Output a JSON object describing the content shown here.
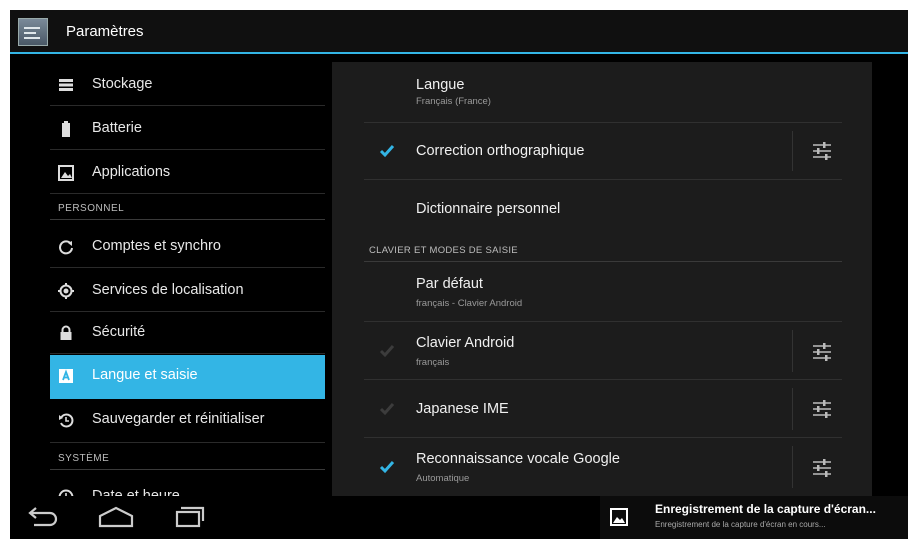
{
  "action_bar": {
    "title": "Paramètres"
  },
  "left_pane": {
    "items_top": [
      {
        "label": "Stockage",
        "icon": "storage-icon"
      },
      {
        "label": "Batterie",
        "icon": "battery-icon"
      },
      {
        "label": "Applications",
        "icon": "apps-icon"
      }
    ],
    "section_personal": "PERSONNEL",
    "items_personal": [
      {
        "label": "Comptes et synchro",
        "icon": "sync-icon"
      },
      {
        "label": "Services de localisation",
        "icon": "location-icon"
      },
      {
        "label": "Sécurité",
        "icon": "lock-icon"
      },
      {
        "label": "Langue et saisie",
        "icon": "language-icon",
        "selected": true
      },
      {
        "label": "Sauvegarder et réinitialiser",
        "icon": "backup-icon"
      }
    ],
    "section_system": "SYSTÈME",
    "items_system": [
      {
        "label": "Date et heure",
        "icon": "clock-icon"
      }
    ]
  },
  "right_pane": {
    "language": {
      "title": "Langue",
      "subtitle": "Français (France)"
    },
    "spellcheck": {
      "title": "Correction orthographique",
      "checked": true
    },
    "dictionary": {
      "title": "Dictionnaire personnel"
    },
    "section_keyboard": "CLAVIER ET MODES DE SAISIE",
    "default_kb": {
      "title": "Par défaut",
      "subtitle": "français - Clavier Android"
    },
    "android_kb": {
      "title": "Clavier Android",
      "subtitle": "français",
      "checked": true,
      "enabled": false
    },
    "japanese_ime": {
      "title": "Japanese IME",
      "checked": true,
      "enabled": false
    },
    "google_voice": {
      "title": "Reconnaissance vocale Google",
      "subtitle": "Automatique",
      "checked": true
    }
  },
  "nav_bar": {
    "buttons": [
      "back-icon",
      "home-icon",
      "recent-apps-icon"
    ]
  },
  "notification": {
    "title": "Enregistrement de la capture d'écran...",
    "text": "Enregistrement de la capture d'écran en cours...",
    "icon": "screenshot-icon"
  },
  "colors": {
    "accent": "#33b5e5",
    "background": "#000000",
    "pane": "#1c1c1c"
  }
}
